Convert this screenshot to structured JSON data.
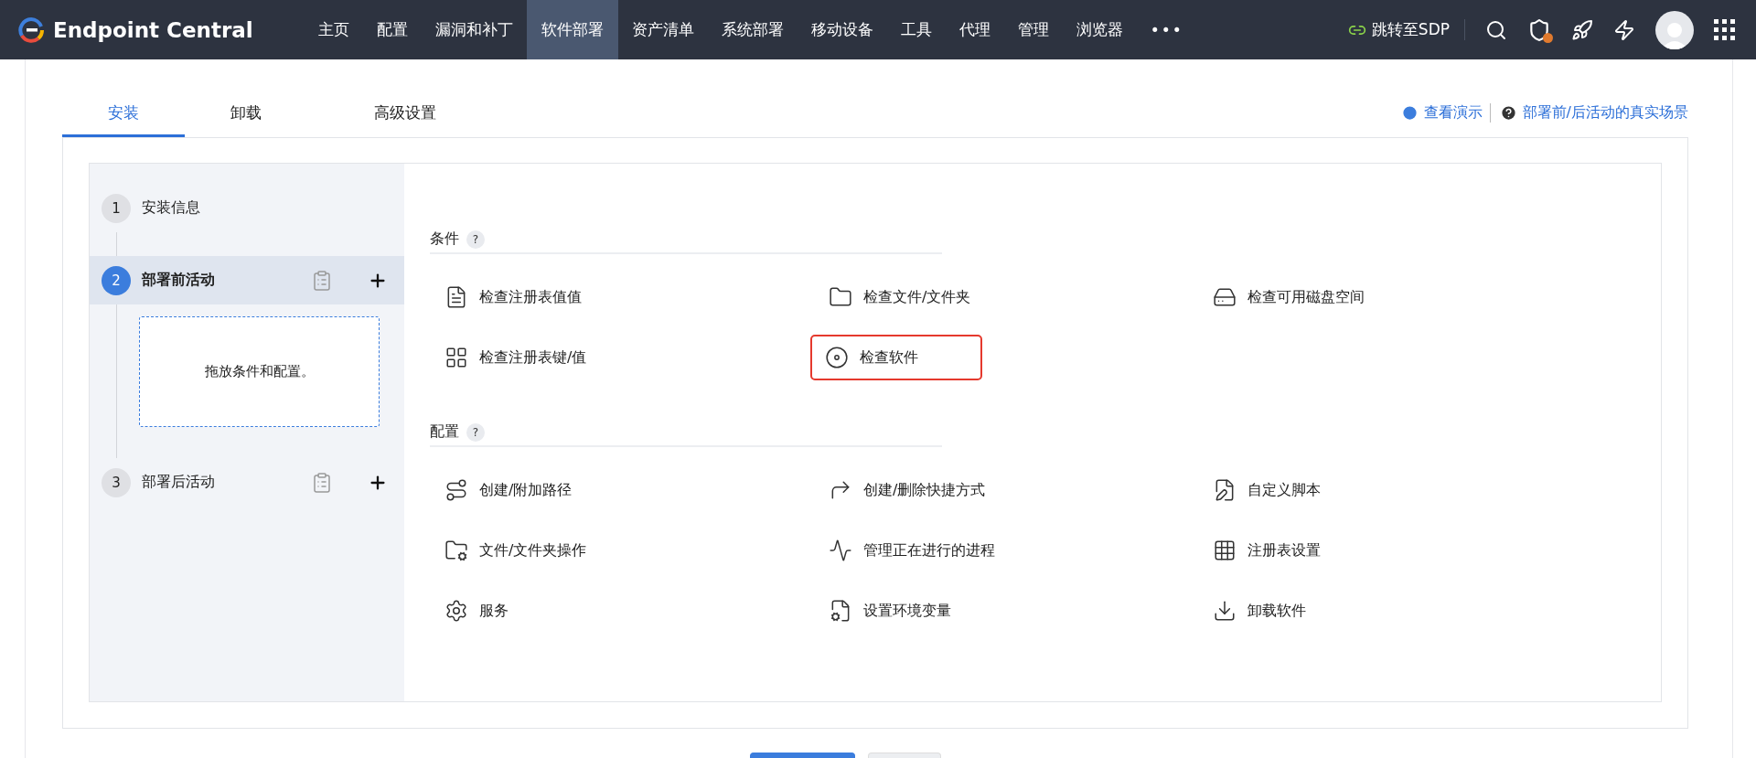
{
  "navbar": {
    "logo": "Endpoint Central",
    "items": [
      {
        "label": "主页",
        "selected": false
      },
      {
        "label": "配置",
        "selected": false
      },
      {
        "label": "漏洞和补丁",
        "selected": false
      },
      {
        "label": "软件部署",
        "selected": true
      },
      {
        "label": "资产清单",
        "selected": false
      },
      {
        "label": "系统部署",
        "selected": false
      },
      {
        "label": "移动设备",
        "selected": false
      },
      {
        "label": "工具",
        "selected": false
      },
      {
        "label": "代理",
        "selected": false
      },
      {
        "label": "管理",
        "selected": false
      },
      {
        "label": "浏览器",
        "selected": false
      }
    ],
    "more": "•••",
    "sdp_link": "跳转至SDP"
  },
  "tabs": [
    {
      "label": "安装",
      "selected": true
    },
    {
      "label": "卸载",
      "selected": false
    },
    {
      "label": "高级设置",
      "selected": false
    }
  ],
  "help_links": [
    {
      "kind": "demo",
      "label": "查看演示"
    },
    {
      "kind": "help",
      "label": "部署前/后活动的真实场景"
    }
  ],
  "steps": [
    {
      "number": "1",
      "label": "安装信息",
      "selected": false
    },
    {
      "number": "2",
      "label": "部署前活动",
      "selected": true,
      "drop_zone": "拖放条件和配置。"
    },
    {
      "number": "3",
      "label": "部署后活动",
      "selected": false
    }
  ],
  "sections": [
    {
      "title": "条件",
      "help": "?",
      "items": [
        {
          "label": "检查注册表值值",
          "highlighted": false
        },
        {
          "label": "检查文件/文件夹",
          "highlighted": false
        },
        {
          "label": "检查可用磁盘空间",
          "highlighted": false
        },
        {
          "label": "检查注册表键/值",
          "highlighted": false
        },
        {
          "label": "检查软件",
          "highlighted": true
        }
      ]
    },
    {
      "title": "配置",
      "help": "?",
      "items": [
        {
          "label": "创建/附加路径",
          "highlighted": false
        },
        {
          "label": "创建/删除快捷方式",
          "highlighted": false
        },
        {
          "label": "自定义脚本",
          "highlighted": false
        },
        {
          "label": "文件/文件夹操作",
          "highlighted": false
        },
        {
          "label": "管理正在进行的进程",
          "highlighted": false
        },
        {
          "label": "注册表设置",
          "highlighted": false
        },
        {
          "label": "服务",
          "highlighted": false
        },
        {
          "label": "设置环境变量",
          "highlighted": false
        },
        {
          "label": "卸载软件",
          "highlighted": false
        }
      ]
    }
  ],
  "footer_buttons": [
    {
      "kind": "primary"
    },
    {
      "kind": "secondary"
    }
  ]
}
